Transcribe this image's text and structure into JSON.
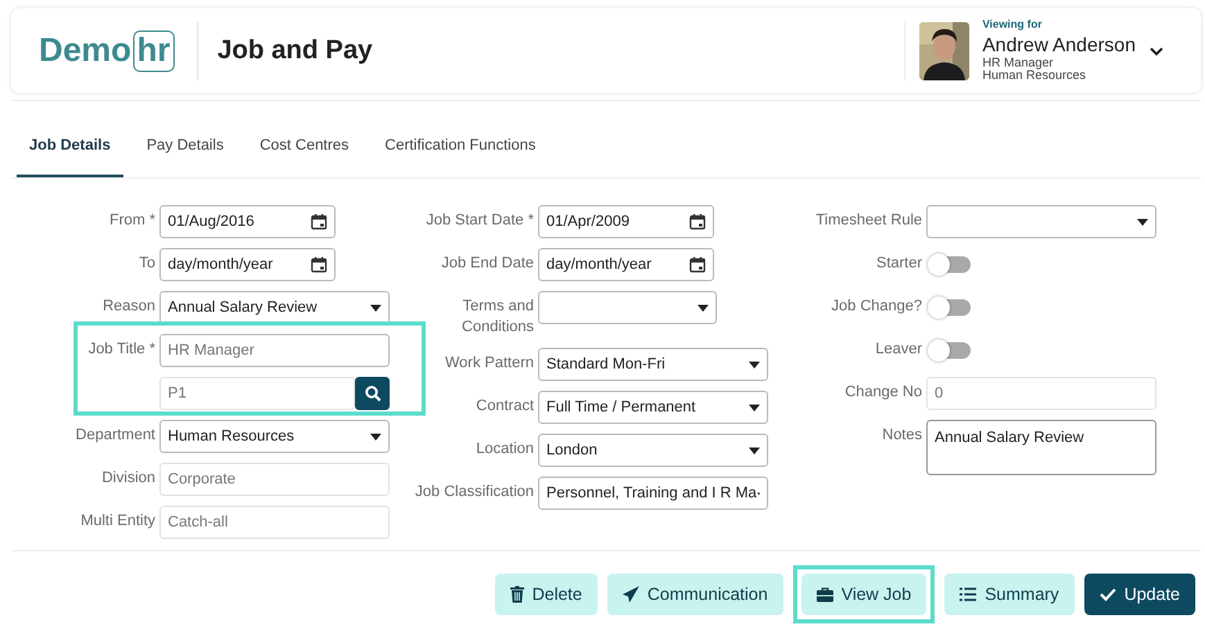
{
  "header": {
    "logo": {
      "plain": "Demo",
      "boxed": "hr"
    },
    "title": "Job and Pay",
    "user": {
      "viewing_label": "Viewing for",
      "name": "Andrew Anderson",
      "role": "HR Manager",
      "department": "Human Resources"
    }
  },
  "tabs": [
    {
      "label": "Job Details",
      "selected": true
    },
    {
      "label": "Pay Details",
      "selected": false
    },
    {
      "label": "Cost Centres",
      "selected": false
    },
    {
      "label": "Certification Functions",
      "selected": false
    }
  ],
  "columns": [
    {
      "fields": [
        {
          "kind": "date",
          "label": "From *",
          "value": "01/Aug/2016"
        },
        {
          "kind": "date",
          "label": "To",
          "value": "day/month/year"
        },
        {
          "kind": "select",
          "label": "Reason",
          "value": "Annual Salary Review"
        },
        {
          "kind": "lookup",
          "label": "Job Title *",
          "value": "HR Manager",
          "code": "P1",
          "disabled": true,
          "highlighted": true
        },
        {
          "kind": "select",
          "label": "Department",
          "value": "Human Resources"
        },
        {
          "kind": "text",
          "label": "Division",
          "value": "Corporate",
          "disabled": true
        },
        {
          "kind": "text",
          "label": "Multi Entity",
          "value": "Catch-all",
          "disabled": true
        }
      ]
    },
    {
      "fields": [
        {
          "kind": "date",
          "label": "Job Start Date *",
          "value": "01/Apr/2009"
        },
        {
          "kind": "date",
          "label": "Job End Date",
          "value": "day/month/year"
        },
        {
          "kind": "select",
          "label": "Terms and Conditions",
          "short": true
        },
        {
          "kind": "select",
          "label": "Work Pattern",
          "value": "Standard Mon-Fri"
        },
        {
          "kind": "select",
          "label": "Contract",
          "value": "Full Time / Permanent"
        },
        {
          "kind": "select",
          "label": "Location",
          "value": "London"
        },
        {
          "kind": "select",
          "label": "Job Classification",
          "value": "Personnel, Training and I R Ma"
        }
      ]
    },
    {
      "fields": [
        {
          "kind": "select",
          "label": "Timesheet Rule",
          "short": false
        },
        {
          "kind": "toggle",
          "label": "Starter",
          "on": false
        },
        {
          "kind": "toggle",
          "label": "Job Change?",
          "on": false
        },
        {
          "kind": "toggle",
          "label": "Leaver",
          "on": false
        },
        {
          "kind": "text",
          "label": "Change No",
          "value": "0",
          "disabled": true
        },
        {
          "kind": "textarea",
          "label": "Notes",
          "value": "Annual Salary Review"
        }
      ]
    }
  ],
  "buttons": [
    {
      "kind": "delete",
      "label": "Delete",
      "primary": false,
      "highlighted": false
    },
    {
      "kind": "communication",
      "label": "Communication",
      "primary": false,
      "highlighted": false
    },
    {
      "kind": "view",
      "label": "View Job",
      "primary": false,
      "highlighted": true
    },
    {
      "kind": "summary",
      "label": "Summary",
      "primary": false,
      "highlighted": false
    },
    {
      "kind": "update",
      "label": "Update",
      "primary": true,
      "highlighted": false
    }
  ]
}
